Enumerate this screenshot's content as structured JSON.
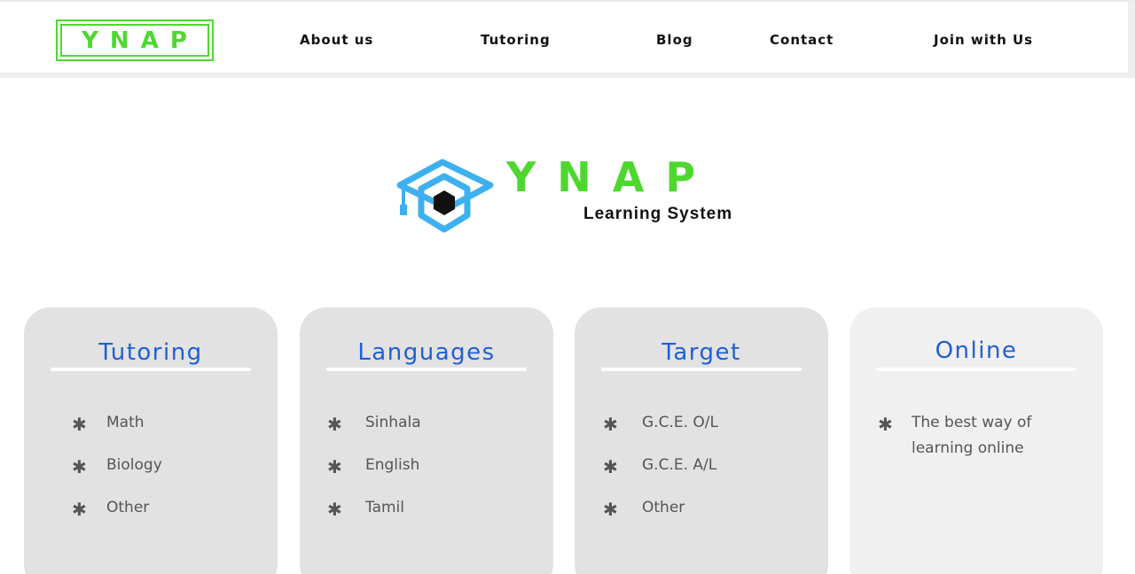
{
  "header": {
    "logo_text": "YNAP",
    "nav": [
      {
        "label": "About us"
      },
      {
        "label": "Tutoring"
      },
      {
        "label": "Blog"
      },
      {
        "label": "Contact"
      },
      {
        "label": "Join with Us"
      }
    ]
  },
  "brand": {
    "name": "YNAP",
    "tagline": "Learning System",
    "icon": "graduation-cap-hexagon-icon",
    "colors": {
      "green": "#4ed82f",
      "blue": "#3db0f0"
    }
  },
  "cards": [
    {
      "title": "Tutoring",
      "items": [
        "Math",
        "Biology",
        "Other"
      ]
    },
    {
      "title": "Languages",
      "items": [
        "Sinhala",
        "English",
        "Tamil"
      ]
    },
    {
      "title": "Target",
      "items": [
        "G.C.E. O/L",
        "G.C.E. A/L",
        "Other"
      ]
    },
    {
      "title": "Online",
      "items": [
        "The best way of learning online"
      ]
    }
  ],
  "bullet_icon": "asterisk-icon",
  "bullet_glyph": "✱",
  "accent_title_color": "#1f5fd6"
}
